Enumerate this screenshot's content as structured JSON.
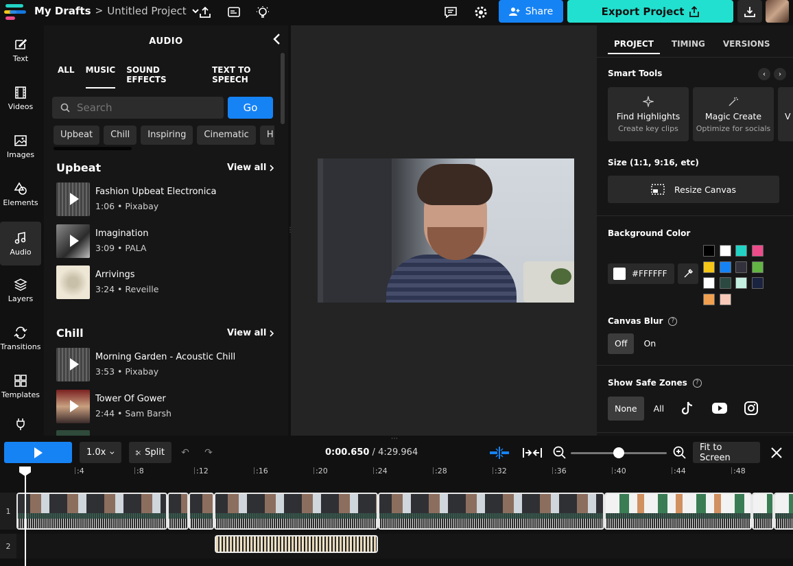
{
  "header": {
    "breadcrumb_root": "My Drafts",
    "breadcrumb_sep": ">",
    "project_name": "Untitled Project",
    "share_label": "Share",
    "export_label": "Export Project"
  },
  "rail": {
    "items": [
      {
        "label": "Text",
        "icon": "text-edit-icon"
      },
      {
        "label": "Videos",
        "icon": "film-icon"
      },
      {
        "label": "Images",
        "icon": "image-icon"
      },
      {
        "label": "Elements",
        "icon": "shapes-icon"
      },
      {
        "label": "Audio",
        "icon": "music-note-icon",
        "active": true
      },
      {
        "label": "Layers",
        "icon": "layers-icon"
      },
      {
        "label": "Transitions",
        "icon": "transitions-icon"
      },
      {
        "label": "Templates",
        "icon": "grid-icon"
      }
    ]
  },
  "audio_panel": {
    "title": "AUDIO",
    "tabs": [
      "ALL",
      "MUSIC",
      "SOUND EFFECTS",
      "TEXT TO SPEECH"
    ],
    "active_tab": "MUSIC",
    "search_placeholder": "Search",
    "go_label": "Go",
    "chips": [
      "Upbeat",
      "Chill",
      "Inspiring",
      "Cinematic",
      "H"
    ],
    "sections": [
      {
        "title": "Upbeat",
        "view_all": "View all",
        "tracks": [
          {
            "name": "Fashion Upbeat Electronica",
            "meta": "1:06 • Pixabay"
          },
          {
            "name": "Imagination",
            "meta": "3:09 • PALA"
          },
          {
            "name": "Arrivings",
            "meta": "3:24 • Reveille"
          }
        ]
      },
      {
        "title": "Chill",
        "view_all": "View all",
        "tracks": [
          {
            "name": "Morning Garden - Acoustic Chill",
            "meta": "3:53 • Pixabay"
          },
          {
            "name": "Tower Of Gower",
            "meta": "2:44 • Sam Barsh"
          }
        ]
      }
    ]
  },
  "props": {
    "tabs": [
      "PROJECT",
      "TIMING",
      "VERSIONS"
    ],
    "active_tab": "PROJECT",
    "smart_tools_label": "Smart Tools",
    "tools": [
      {
        "title": "Find Highlights",
        "subtitle": "Create key clips"
      },
      {
        "title": "Magic Create",
        "subtitle": "Optimize for socials"
      },
      {
        "title": "V",
        "subtitle": ""
      }
    ],
    "size_label": "Size (1:1, 9:16, etc)",
    "resize_label": "Resize Canvas",
    "bg_color_label": "Background Color",
    "bg_hex": "#FFFFFF",
    "swatches": [
      "#000000",
      "#ffffff",
      "#22d3c5",
      "#ee4b8b",
      "#f5c518",
      "#1683f5",
      "#33313b",
      "#62b543",
      "#ffffff",
      "#2b4940",
      "#c4efe1",
      "#1a2340",
      "#f0a050",
      "#f8c8b8"
    ],
    "canvas_blur_label": "Canvas Blur",
    "blur_options": [
      "Off",
      "On"
    ],
    "blur_selected": "Off",
    "safe_zones_label": "Show Safe Zones",
    "safe_zone_options": [
      "None",
      "All"
    ],
    "safe_zone_selected": "None"
  },
  "timeline": {
    "speed": "1.0x",
    "split_label": "Split",
    "current_time": "0:00.650",
    "time_sep": " / ",
    "total_time": "4:29.964",
    "fit_label": "Fit to Screen",
    "zoom_fraction": 0.5,
    "ruler_ticks": [
      ":4",
      ":8",
      ":12",
      ":16",
      ":20",
      ":24",
      ":28",
      ":32",
      ":36",
      ":40",
      ":44",
      ":48"
    ],
    "tracks": [
      "1",
      "2"
    ]
  }
}
